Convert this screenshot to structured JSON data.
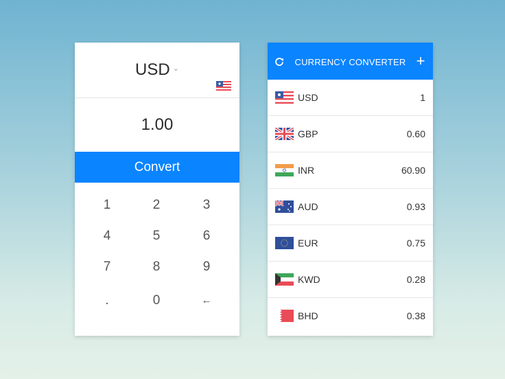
{
  "left": {
    "currency": "USD",
    "currency_flag_icon": "us-flag-icon",
    "amount": "1.00",
    "convert_label": "Convert",
    "keys": [
      "1",
      "2",
      "3",
      "4",
      "5",
      "6",
      "7",
      "8",
      "9",
      ".",
      "0",
      "←"
    ]
  },
  "right": {
    "title": "CURRENCY CONVERTER",
    "refresh_icon": "refresh-icon",
    "add_label": "+",
    "rows": [
      {
        "code": "USD",
        "rate": "1",
        "flag": "us-flag-icon"
      },
      {
        "code": "GBP",
        "rate": "0.60",
        "flag": "uk-flag-icon"
      },
      {
        "code": "INR",
        "rate": "60.90",
        "flag": "india-flag-icon"
      },
      {
        "code": "AUD",
        "rate": "0.93",
        "flag": "australia-flag-icon"
      },
      {
        "code": "EUR",
        "rate": "0.75",
        "flag": "eu-flag-icon"
      },
      {
        "code": "KWD",
        "rate": "0.28",
        "flag": "kuwait-flag-icon"
      },
      {
        "code": "BHD",
        "rate": "0.38",
        "flag": "bahrain-flag-icon"
      }
    ]
  },
  "colors": {
    "accent": "#0a84ff",
    "text": "#333333"
  }
}
